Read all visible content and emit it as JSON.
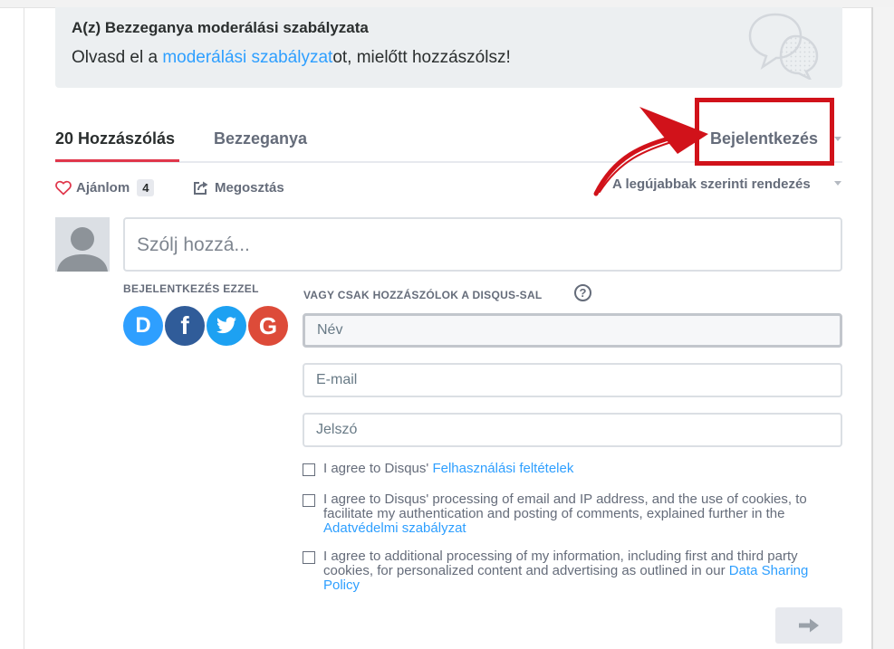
{
  "moderation": {
    "title": "A(z) Bezzeganya moderálási szabályzata",
    "text_before": "Olvasd el a ",
    "link": "moderálási szabályzat",
    "text_after": "ot, mielőtt hozzászólsz!"
  },
  "tabs": {
    "comments": "20 Hozzászólás",
    "community": "Bezzeganya",
    "login": "Bejelentkezés"
  },
  "actions": {
    "recommend_label": "Ajánlom",
    "recommend_count": "4",
    "share_label": "Megosztás",
    "sort_label": "A legújabbak szerinti rendezés"
  },
  "composer": {
    "placeholder": "Szólj hozzá..."
  },
  "login_with": {
    "label": "BEJELENTKEZÉS EZZEL",
    "providers": [
      {
        "name": "disqus",
        "glyph": "D"
      },
      {
        "name": "facebook",
        "glyph": "f"
      },
      {
        "name": "twitter",
        "glyph": ""
      },
      {
        "name": "google",
        "glyph": "G"
      }
    ]
  },
  "guest": {
    "label": "VAGY CSAK HOZZÁSZÓLOK A DISQUS-SAL",
    "help_glyph": "?",
    "name_placeholder": "Név",
    "email_placeholder": "E-mail",
    "password_placeholder": "Jelszó"
  },
  "checkboxes": {
    "terms_text": "I agree to Disqus' ",
    "terms_link": "Felhasználási feltételek",
    "privacy_text": "I agree to Disqus' processing of email and IP address, and the use of cookies, to facilitate my authentication and posting of comments, explained further in the ",
    "privacy_link": "Adatvédelmi szabályzat",
    "sharing_text": "I agree to additional processing of my information, including first and third party cookies, for personalized content and advertising as outlined in our ",
    "sharing_link": "Data Sharing Policy"
  },
  "colors": {
    "accent": "#2e9fff",
    "tab_underline": "#e0364b",
    "highlight_annotation": "#d1121a",
    "disqus": "#2e9fff",
    "facebook": "#305c99",
    "twitter": "#1da1f2",
    "google": "#dd4b39"
  },
  "icons": {
    "moderation": "chat-bubbles-icon",
    "recommend": "heart-icon",
    "share": "share-icon",
    "help": "question-circle-icon",
    "submit": "arrow-right-icon"
  }
}
